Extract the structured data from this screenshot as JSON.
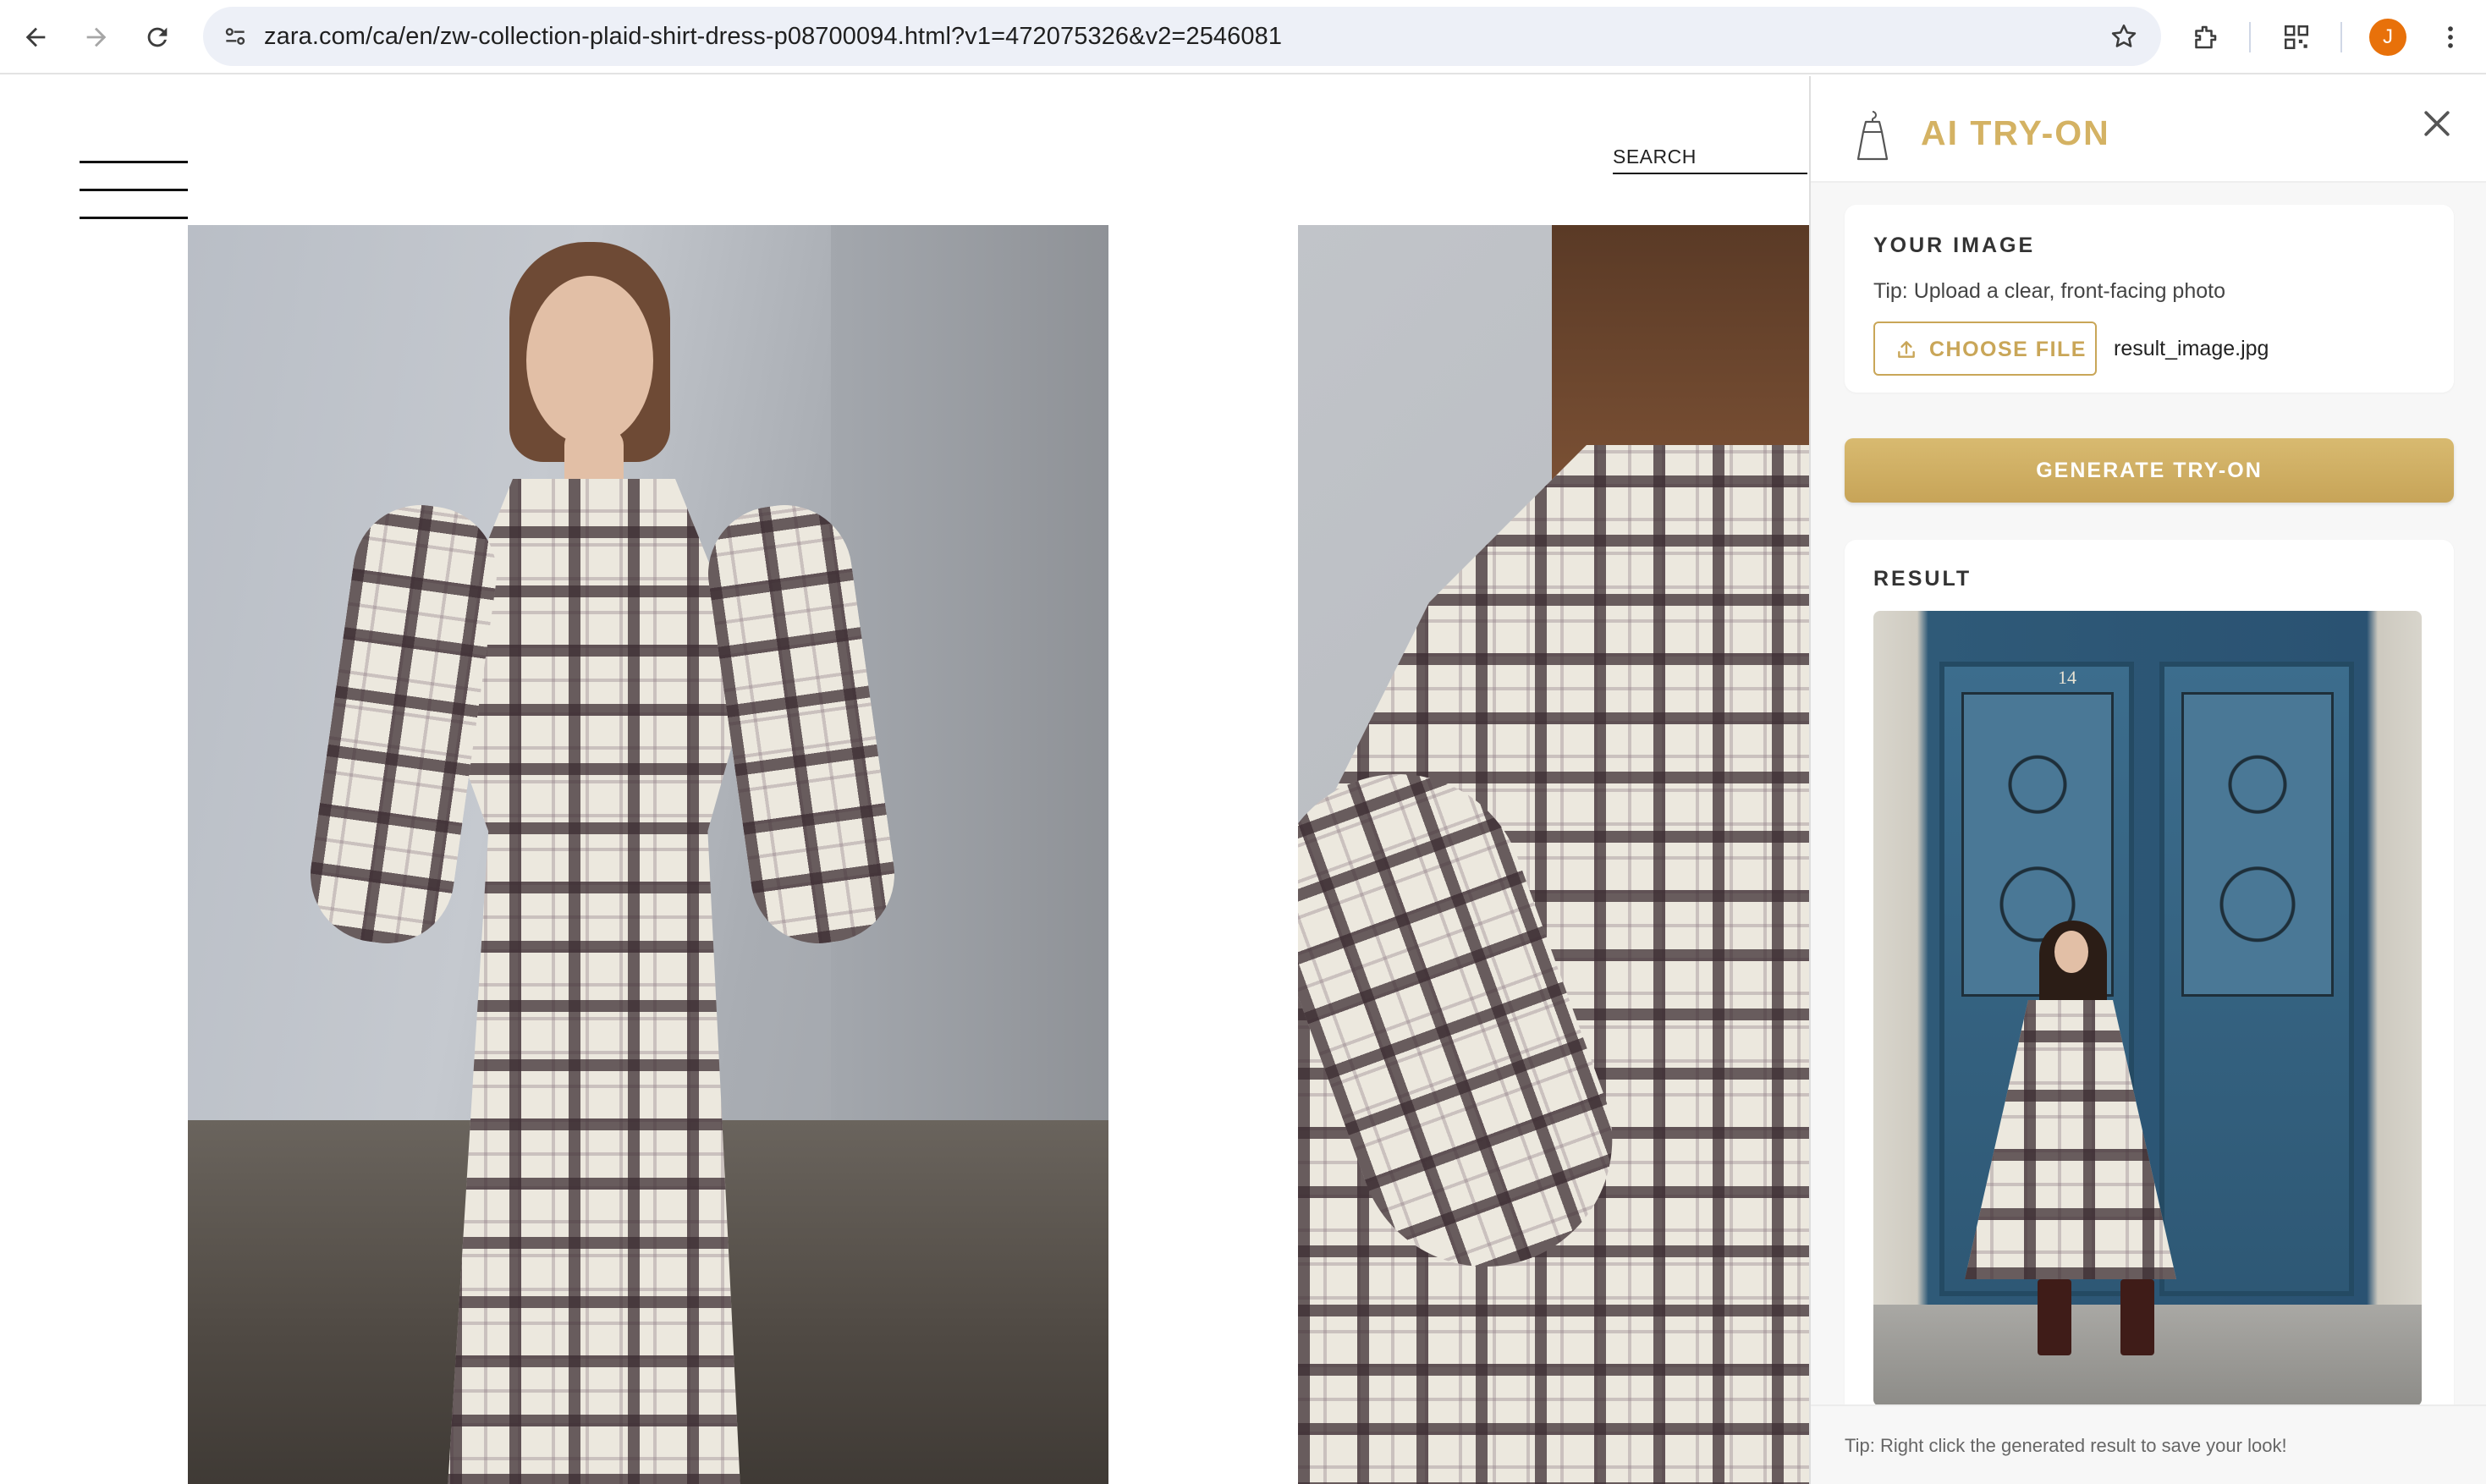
{
  "browser": {
    "url": "zara.com/ca/en/zw-collection-plaid-shirt-dress-p08700094.html?v1=472075326&v2=2546081",
    "profile_initial": "J",
    "profile_color": "#e8710a"
  },
  "page": {
    "search_label": "SEARCH"
  },
  "tryon_panel": {
    "title": "AI TRY-ON",
    "accent_color": "#d4b263",
    "your_image": {
      "heading": "YOUR IMAGE",
      "tip": "Tip: Upload a clear, front-facing photo",
      "choose_button": "CHOOSE FILE",
      "filename": "result_image.jpg"
    },
    "generate_button": "GENERATE TRY-ON",
    "result": {
      "heading": "RESULT",
      "door_number": "14"
    },
    "footer_tip": "Tip: Right click the generated result to save your look!"
  },
  "icons": [
    "back-arrow-icon",
    "forward-arrow-icon",
    "reload-icon",
    "site-settings-icon",
    "star-icon",
    "extensions-icon",
    "qr-code-icon",
    "more-menu-icon",
    "hamburger-menu-icon",
    "dress-logo-icon",
    "close-icon",
    "upload-icon"
  ]
}
